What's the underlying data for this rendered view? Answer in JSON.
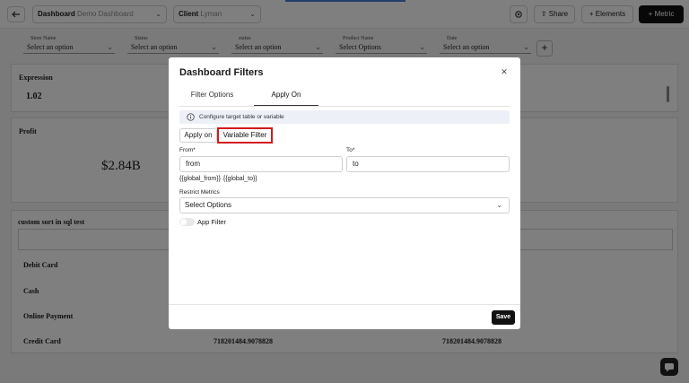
{
  "topbar": {
    "dashboard_label": "Dashboard",
    "dashboard_value": "Demo Dashboard",
    "client_label": "Client",
    "client_value": "Lyman",
    "share_label": "Share",
    "elements_label": "Elements",
    "metric_label": "Metric"
  },
  "filters": [
    {
      "label": "Store Name",
      "placeholder": "Select an option"
    },
    {
      "label": "Status",
      "placeholder": "Select an option"
    },
    {
      "label": "status",
      "placeholder": "Select an option"
    },
    {
      "label": "Product Name",
      "placeholder": "Select Options"
    },
    {
      "label": "Date",
      "placeholder": "Select an option"
    }
  ],
  "cards": {
    "expression": {
      "title": "Expression",
      "value": "1.02"
    },
    "profit": {
      "title": "Profit",
      "value": "$2.84B"
    },
    "table": {
      "title": "custom sort in sql test",
      "rows": [
        {
          "label": "Debit Card",
          "col1": "",
          "col2": ""
        },
        {
          "label": "Cash",
          "col1": "",
          "col2": ""
        },
        {
          "label": "Online Payment",
          "col1": "",
          "col2": ""
        },
        {
          "label": "Credit Card",
          "col1": "718201484.9078828",
          "col2": "718201484.9078828"
        }
      ]
    }
  },
  "modal": {
    "title": "Dashboard Filters",
    "tabs": [
      {
        "label": "Filter Options"
      },
      {
        "label": "Apply On"
      }
    ],
    "info_text": "Configure target table or variable",
    "apply_on_label": "Apply on",
    "variable_filter_label": "Variable Filter",
    "from_label": "From*",
    "from_value": "from",
    "to_label": "To*",
    "to_value": "to",
    "variable_hint": "{{global_from}}  {{global_to}}",
    "restrict_metrics_label": "Restrict Metrics",
    "restrict_metrics_placeholder": "Select Options",
    "app_filter_label": "App Filter",
    "save_label": "Save"
  },
  "icons": {
    "back": "arrow-left-icon",
    "settings": "gear-icon",
    "share": "share-icon",
    "add": "plus-icon",
    "close": "close-icon",
    "info": "info-icon",
    "chevron": "chevron-down-icon",
    "chat": "chat-icon"
  }
}
